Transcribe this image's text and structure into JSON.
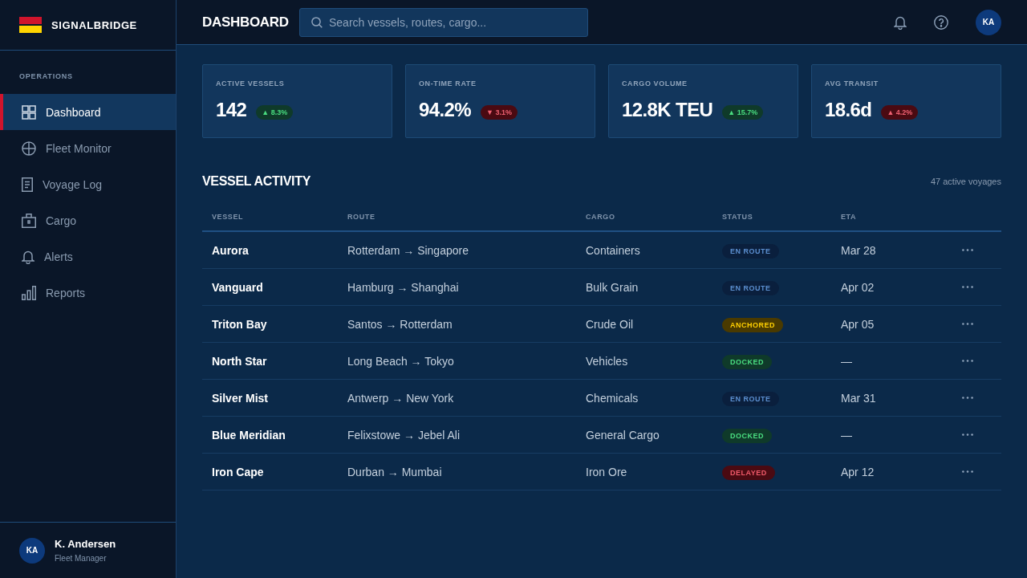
{
  "sidebar": {
    "brand": "SIGNALBRIDGE",
    "section_label": "OPERATIONS",
    "items": [
      {
        "label": "Dashboard",
        "selected": true
      },
      {
        "label": "Fleet Monitor",
        "selected": false
      },
      {
        "label": "Voyage Log",
        "selected": false
      },
      {
        "label": "Cargo",
        "selected": false
      },
      {
        "label": "Alerts",
        "selected": false
      },
      {
        "label": "Reports",
        "selected": false
      }
    ],
    "user": {
      "initials": "KA",
      "name": "K. Andersen",
      "role": "Fleet Manager"
    }
  },
  "header": {
    "title": "DASHBOARD",
    "search": {
      "placeholder": "Search vessels, routes, cargo..."
    },
    "avatar_initials": "KA"
  },
  "stats": [
    {
      "label": "ACTIVE VESSELS",
      "value": "142",
      "change": "▲ 8.3%",
      "kind": "positive"
    },
    {
      "label": "ON-TIME RATE",
      "value": "94.2%",
      "change": "▼ 3.1%",
      "kind": "negative"
    },
    {
      "label": "CARGO VOLUME",
      "value": "12.8K TEU",
      "change": "▲ 15.7%",
      "kind": "positive"
    },
    {
      "label": "AVG TRANSIT",
      "value": "18.6d",
      "change": "▲ 4.2%",
      "kind": "negative"
    }
  ],
  "activity": {
    "title": "VESSEL ACTIVITY",
    "meta": "47 active voyages",
    "table": {
      "columns": [
        "VESSEL",
        "ROUTE",
        "CARGO",
        "STATUS",
        "ETA"
      ],
      "rows": [
        {
          "vessel": "Aurora",
          "route": "Rotterdam → Singapore",
          "cargo": "Containers",
          "status": {
            "label": "EN ROUTE",
            "kind": "en_route"
          },
          "eta": "Mar 28"
        },
        {
          "vessel": "Vanguard",
          "route": "Hamburg → Shanghai",
          "cargo": "Bulk Grain",
          "status": {
            "label": "EN ROUTE",
            "kind": "en_route"
          },
          "eta": "Apr 02"
        },
        {
          "vessel": "Triton Bay",
          "route": "Santos → Rotterdam",
          "cargo": "Crude Oil",
          "status": {
            "label": "ANCHORED",
            "kind": "anchored"
          },
          "eta": "Apr 05"
        },
        {
          "vessel": "North Star",
          "route": "Long Beach → Tokyo",
          "cargo": "Vehicles",
          "status": {
            "label": "DOCKED",
            "kind": "docked"
          },
          "eta": "—"
        },
        {
          "vessel": "Silver Mist",
          "route": "Antwerp → New York",
          "cargo": "Chemicals",
          "status": {
            "label": "EN ROUTE",
            "kind": "en_route"
          },
          "eta": "Mar 31"
        },
        {
          "vessel": "Blue Meridian",
          "route": "Felixstowe → Jebel Ali",
          "cargo": "General Cargo",
          "status": {
            "label": "DOCKED",
            "kind": "docked"
          },
          "eta": "—"
        },
        {
          "vessel": "Iron Cape",
          "route": "Durban → Mumbai",
          "cargo": "Iron Ore",
          "status": {
            "label": "DELAYED",
            "kind": "delayed"
          },
          "eta": "Apr 12"
        }
      ]
    }
  }
}
